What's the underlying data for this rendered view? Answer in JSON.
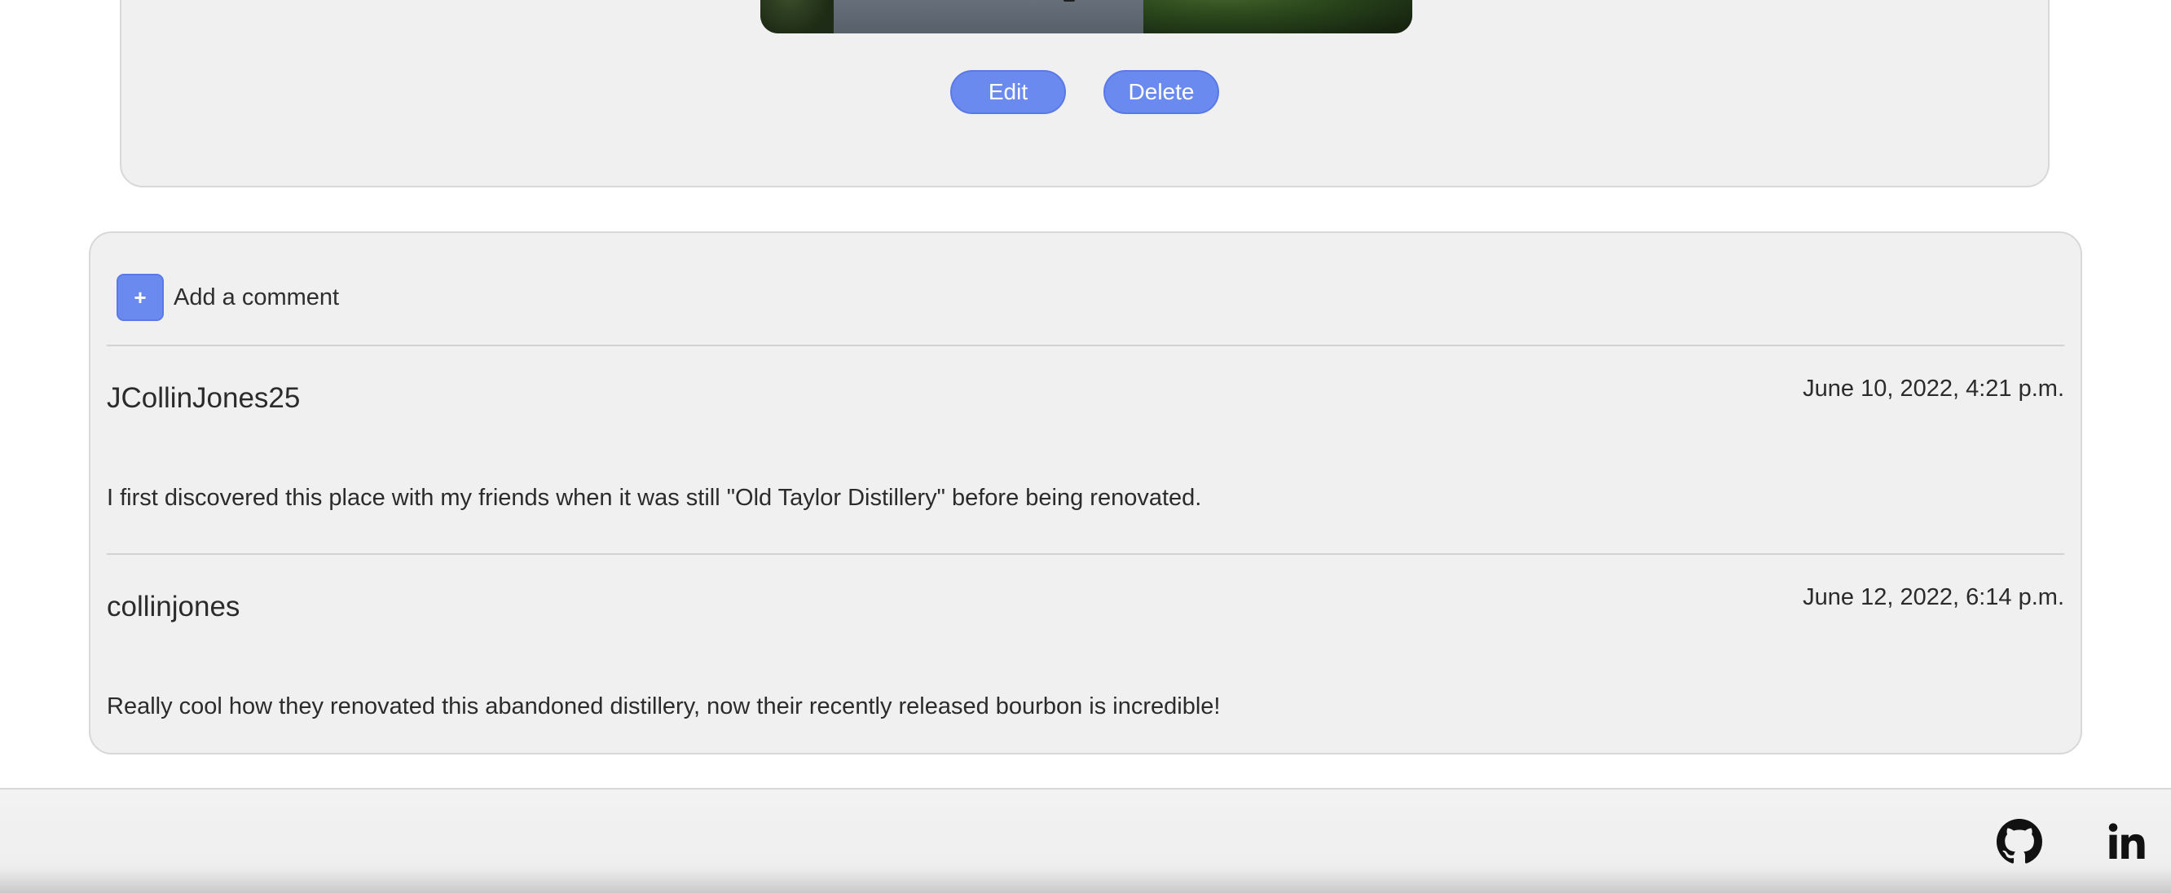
{
  "post": {
    "image_alt": "",
    "edit_label": "Edit",
    "delete_label": "Delete"
  },
  "comments_section": {
    "add_comment_icon": "+",
    "add_comment_label": "Add a comment",
    "comments": [
      {
        "username": "JCollinJones25",
        "date": "June 10, 2022, 4:21 p.m.",
        "text": "I first discovered this place with my friends when it was still \"Old Taylor Distillery\" before being renovated."
      },
      {
        "username": "collinjones",
        "date": "June 12, 2022, 6:14 p.m.",
        "text": "Really cool how they renovated this abandoned distillery, now their recently released bourbon is incredible!"
      }
    ]
  },
  "footer": {
    "icons": [
      "github-icon",
      "linkedin-icon"
    ]
  },
  "colors": {
    "accent": "#6b8af0",
    "card_bg": "#f0f0f0",
    "border": "#d8d8d8",
    "text": "#2b2b2b"
  }
}
